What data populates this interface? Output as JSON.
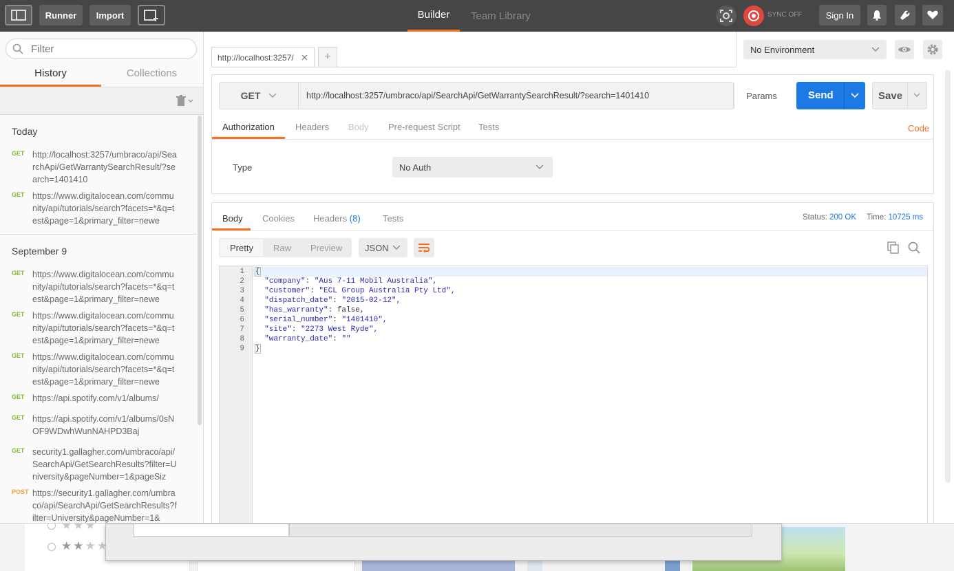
{
  "topbar": {
    "runner": "Runner",
    "import": "Import",
    "builder": "Builder",
    "team_library": "Team Library",
    "sync": "SYNC OFF",
    "sign_in": "Sign In",
    "accent": "#f47023"
  },
  "sidebar": {
    "filter_placeholder": "Filter",
    "tab_history": "History",
    "tab_collections": "Collections",
    "groups": [
      {
        "label": "Today",
        "items": [
          {
            "method": "GET",
            "url": "http://localhost:3257/umbraco/api/SearchApi/GetWarrantySearchResult/?search=1401410"
          },
          {
            "method": "GET",
            "url": "https://www.digitalocean.com/community/api/tutorials/search?facets=*&q=test&page=1&primary_filter=newe"
          }
        ]
      },
      {
        "label": "September 9",
        "items": [
          {
            "method": "GET",
            "url": "https://www.digitalocean.com/community/api/tutorials/search?facets=*&q=test&page=1&primary_filter=newe"
          },
          {
            "method": "GET",
            "url": "https://www.digitalocean.com/community/api/tutorials/search?facets=*&q=test&page=1&primary_filter=newe"
          },
          {
            "method": "GET",
            "url": "https://www.digitalocean.com/community/api/tutorials/search?facets=*&q=test&page=1&primary_filter=newe"
          },
          {
            "method": "GET",
            "url": "https://api.spotify.com/v1/albums/"
          },
          {
            "method": "GET",
            "url": "https://api.spotify.com/v1/albums/0sNOF9WDwhWunNAHPD3Baj"
          },
          {
            "method": "GET",
            "url": "security1.gallagher.com/umbraco/api/SearchApi/GetSearchResults?filter=University&pageNumber=1&pageSiz"
          },
          {
            "method": "POST",
            "url": "https://security1.gallagher.com/umbraco/api/SearchApi/GetSearchResults?filter=University&pageNumber=1&"
          }
        ]
      }
    ]
  },
  "request": {
    "tab_title": "http://localhost:3257/",
    "environment": "No Environment",
    "method": "GET",
    "url": "http://localhost:3257/umbraco/api/SearchApi/GetWarrantySearchResult/?search=1401410",
    "params": "Params",
    "send": "Send",
    "save": "Save",
    "tabs": [
      "Authorization",
      "Headers",
      "Body",
      "Pre-request Script",
      "Tests"
    ],
    "code": "Code",
    "auth_type_label": "Type",
    "auth_type_value": "No Auth"
  },
  "response": {
    "tabs": {
      "body": "Body",
      "cookies": "Cookies",
      "headers": "Headers",
      "headers_count": "(8)",
      "tests": "Tests"
    },
    "status_label": "Status:",
    "status_value": "200 OK",
    "time_label": "Time:",
    "time_value": "10725 ms",
    "formats": [
      "Pretty",
      "Raw",
      "Preview"
    ],
    "language": "JSON",
    "lines": [
      {
        "n": "1",
        "text": "{"
      },
      {
        "n": "2",
        "key": "company",
        "val": "\"Aus 7-11 Mobil Australia\","
      },
      {
        "n": "3",
        "key": "customer",
        "val": "\"ECL Group Australia Pty Ltd\","
      },
      {
        "n": "4",
        "key": "dispatch_date",
        "val": "\"2015-02-12\","
      },
      {
        "n": "5",
        "key": "has_warranty",
        "val": "false,"
      },
      {
        "n": "6",
        "key": "serial_number",
        "val": "\"1401410\","
      },
      {
        "n": "7",
        "key": "site",
        "val": "\"2273 West Ryde\","
      },
      {
        "n": "8",
        "key": "warranty_date",
        "val": "\"\""
      },
      {
        "n": "9",
        "text": "}"
      }
    ]
  }
}
